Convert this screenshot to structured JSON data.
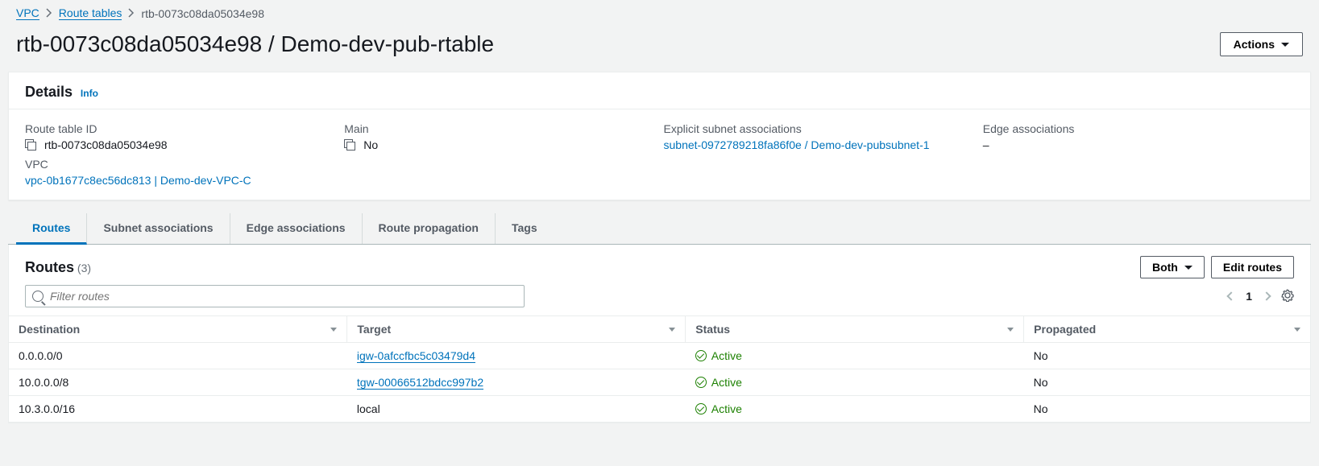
{
  "breadcrumb": {
    "root": "VPC",
    "parent": "Route tables",
    "current": "rtb-0073c08da05034e98"
  },
  "header": {
    "title": "rtb-0073c08da05034e98 / Demo-dev-pub-rtable",
    "actions_label": "Actions"
  },
  "details": {
    "panel_title": "Details",
    "info_label": "Info",
    "route_table_id": {
      "label": "Route table ID",
      "value": "rtb-0073c08da05034e98"
    },
    "main": {
      "label": "Main",
      "value": "No"
    },
    "explicit_assoc": {
      "label": "Explicit subnet associations",
      "value": "subnet-0972789218fa86f0e / Demo-dev-pubsubnet-1"
    },
    "edge_assoc": {
      "label": "Edge associations",
      "value": "–"
    },
    "vpc": {
      "label": "VPC",
      "value": "vpc-0b1677c8ec56dc813 | Demo-dev-VPC-C"
    }
  },
  "tabs": {
    "routes": "Routes",
    "subnet_assoc": "Subnet associations",
    "edge_assoc": "Edge associations",
    "route_prop": "Route propagation",
    "tags": "Tags"
  },
  "routes_panel": {
    "title": "Routes",
    "count": "(3)",
    "both_label": "Both",
    "edit_label": "Edit routes",
    "filter_placeholder": "Filter routes",
    "page_num": "1",
    "columns": {
      "destination": "Destination",
      "target": "Target",
      "status": "Status",
      "propagated": "Propagated"
    },
    "rows": [
      {
        "destination": "0.0.0.0/0",
        "target": "igw-0afccfbc5c03479d4",
        "target_is_link": true,
        "status": "Active",
        "propagated": "No"
      },
      {
        "destination": "10.0.0.0/8",
        "target": "tgw-00066512bdcc997b2",
        "target_is_link": true,
        "status": "Active",
        "propagated": "No"
      },
      {
        "destination": "10.3.0.0/16",
        "target": "local",
        "target_is_link": false,
        "status": "Active",
        "propagated": "No"
      }
    ]
  }
}
